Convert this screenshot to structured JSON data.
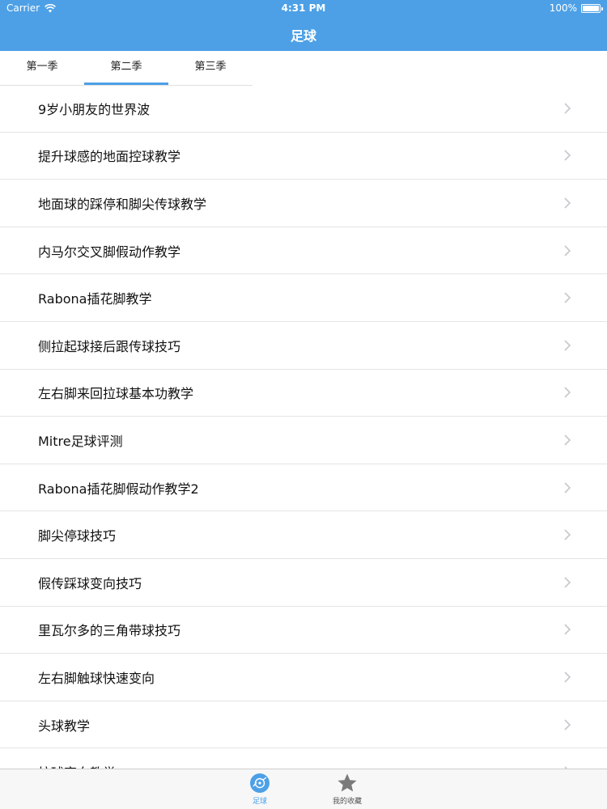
{
  "status_bar": {
    "carrier": "Carrier",
    "time": "4:31 PM",
    "battery": "100%"
  },
  "nav": {
    "title": "足球"
  },
  "tabs": [
    {
      "label": "第一季",
      "active": false
    },
    {
      "label": "第二季",
      "active": true
    },
    {
      "label": "第三季",
      "active": false
    }
  ],
  "list": {
    "items": [
      "9岁小朋友的世界波",
      "提升球感的地面控球教学",
      "地面球的踩停和脚尖传球教学",
      "内马尔交叉脚假动作教学",
      "Rabona插花脚教学",
      "侧拉起球接后跟传球技巧",
      "左右脚来回拉球基本功教学",
      "Mitre足球评测",
      "Rabona插花脚假动作教学2",
      "脚尖停球技巧",
      "假传踩球变向技巧",
      "里瓦尔多的三角带球技巧",
      "左右脚触球快速变向",
      "头球教学",
      "拉球变向教学"
    ]
  },
  "tabbar": {
    "items": [
      {
        "label": "足球",
        "icon": "soccer-disc-icon",
        "active": true
      },
      {
        "label": "我的收藏",
        "icon": "star-icon",
        "active": false
      }
    ]
  },
  "colors": {
    "accent": "#4da0e6",
    "divider": "#e5e5e5",
    "chevron": "#c7c7cc"
  }
}
